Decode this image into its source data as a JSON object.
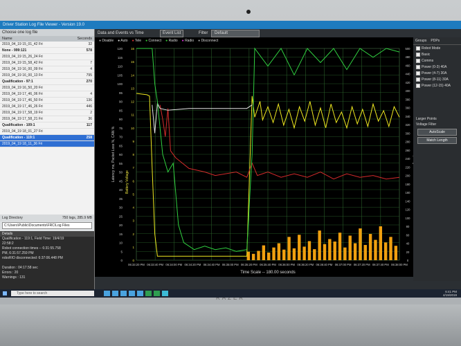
{
  "window": {
    "title": "Driver Station Log File Viewer - Version 19.0"
  },
  "sidebar": {
    "header": "Choose one log file",
    "columns": [
      "Name",
      "Seconds"
    ],
    "rows": [
      {
        "name": "2019_04_19 15_01_42 Fri",
        "value": "32"
      },
      {
        "name": "None - 999:121",
        "value": "578"
      },
      {
        "name": "2019_04_19 15_26_24 Fri",
        "value": ""
      },
      {
        "name": "2019_04_19 15_58_42 Fri",
        "value": "7"
      },
      {
        "name": "2019_04_19 16_00_09 Fri",
        "value": "4"
      },
      {
        "name": "2019_04_19 16_00_13 Fri",
        "value": "795"
      },
      {
        "name": "Qualification - 97:1",
        "value": "270"
      },
      {
        "name": "2019_04_19 16_50_20 Fri",
        "value": ""
      },
      {
        "name": "2019_04_19 17_46_06 Fri",
        "value": "4"
      },
      {
        "name": "2019_04_19 17_46_50 Fri",
        "value": "136"
      },
      {
        "name": "2019_04_19 17_46_26 Fri",
        "value": "446"
      },
      {
        "name": "2019_04_19 17_58_19 Fri",
        "value": "2"
      },
      {
        "name": "2019_04_19 17_58_21 Fri",
        "value": "36"
      },
      {
        "name": "Qualification - 109:1",
        "value": "117"
      },
      {
        "name": "2019_04_19 18_01_27 Fri",
        "value": ""
      },
      {
        "name": "Qualification - 119:1",
        "value": "258"
      },
      {
        "name": "2019_04_19 18_11_36 Fri",
        "value": ""
      }
    ],
    "log_dir_label": "Log Directory",
    "log_dir_info": "750 logs, 285.9 MB",
    "log_path": "C:\\Users\\Public\\Documents\\FRC\\Log Files"
  },
  "details": {
    "header": "Details",
    "lines": [
      "Qualification - 119:1, Field Time: 19/4/19",
      "22:58:2",
      "Robot connection times -- 6:31:55.758",
      "PM, 6:31:57.259 PM",
      "roboRIO disconnected: 6:37:06.448 PM",
      "",
      "Duration : 04:17.58 sec",
      "Errors : 20",
      "Warnings : 131"
    ]
  },
  "topbar": {
    "view_label": "Data and Events vs Time",
    "event_tab": "Event List",
    "filter_label": "Filter",
    "filter_value": "Default"
  },
  "legend": [
    "Disable",
    "Auto",
    "Tele",
    "Connect",
    "Radio",
    "Radio",
    "Disconnect"
  ],
  "right_panel": {
    "tabs": [
      "Groups",
      "PDPs"
    ],
    "checks": [
      "Robot Mode",
      "Basic",
      "Comms",
      "Power (0-3) 40A",
      "Power (4-7) 30A",
      "Power (8-11) 30A",
      "Power (12-15) 40A"
    ],
    "larger_points": "Larger Points",
    "voltage_filter": "Voltage Filter",
    "autoscale": "AutoScale",
    "match_length": "Match Length"
  },
  "chart_data": {
    "type": "line",
    "xlabel": "Time Scale -- 180.00 seconds",
    "ylabel_left": "Latency ms, Packet Loss %, CAN %",
    "ylabel_right": "PDP Amperage",
    "ylabel_voltage": "Battery Voltage",
    "y_left_ticks": [
      "120",
      "115",
      "110",
      "105",
      "100",
      "95",
      "90",
      "85",
      "80",
      "75",
      "70",
      "65",
      "60",
      "55",
      "50",
      "45",
      "40",
      "35",
      "30",
      "25",
      "20",
      "15",
      "10",
      "5",
      "0"
    ],
    "y_voltage_ticks": [
      "16",
      "15",
      "14",
      "13",
      "12",
      "11",
      "10",
      "9",
      "8",
      "7",
      "6",
      "5",
      "4",
      "3",
      "2",
      "1",
      "0"
    ],
    "y_right_ticks": [
      "500",
      "480",
      "460",
      "440",
      "420",
      "400",
      "380",
      "360",
      "340",
      "320",
      "300",
      "280",
      "260",
      "240",
      "220",
      "200",
      "180",
      "160",
      "140",
      "120",
      "100",
      "80",
      "60",
      "40",
      "20",
      "0"
    ],
    "x_ticks": [
      "06:33:20 PM",
      "06:33:40 PM",
      "06:34:00 PM",
      "06:34:20 PM",
      "06:34:40 PM",
      "06:35:00 PM",
      "06:35:20 PM",
      "06:35:40 PM",
      "06:36:00 PM",
      "06:36:20 PM",
      "06:36:40 PM",
      "06:37:00 PM",
      "06:37:20 PM",
      "06:37:40 PM",
      "06:38:00 PM"
    ],
    "series": [
      {
        "name": "Battery Voltage",
        "color": "#f0ea20",
        "points": [
          [
            0,
            12.6
          ],
          [
            0.04,
            12.5
          ],
          [
            0.05,
            12.4
          ],
          [
            0.06,
            7.0
          ],
          [
            0.07,
            2.0
          ],
          [
            0.08,
            0.3
          ],
          [
            0.42,
            0.3
          ],
          [
            0.44,
            12.4
          ],
          [
            0.45,
            10.8
          ],
          [
            0.47,
            12.0
          ],
          [
            0.48,
            10.6
          ],
          [
            0.5,
            11.6
          ],
          [
            0.52,
            10.4
          ],
          [
            0.54,
            11.8
          ],
          [
            0.56,
            10.2
          ],
          [
            0.58,
            11.4
          ],
          [
            0.6,
            10.0
          ],
          [
            0.62,
            11.6
          ],
          [
            0.64,
            10.5
          ],
          [
            0.66,
            12.0
          ],
          [
            0.68,
            10.2
          ],
          [
            0.7,
            11.5
          ],
          [
            0.72,
            10.0
          ],
          [
            0.74,
            11.8
          ],
          [
            0.76,
            10.4
          ],
          [
            0.78,
            11.2
          ],
          [
            0.8,
            10.0
          ],
          [
            0.82,
            11.6
          ],
          [
            0.84,
            10.3
          ],
          [
            0.86,
            11.4
          ],
          [
            0.88,
            10.1
          ],
          [
            0.9,
            11.8
          ],
          [
            0.92,
            10.5
          ],
          [
            0.94,
            11.3
          ],
          [
            0.96,
            10.1
          ],
          [
            0.98,
            11.6
          ],
          [
            1.0,
            10.8
          ]
        ]
      },
      {
        "name": "CAN %",
        "color": "#d42b2b",
        "points": [
          [
            0.09,
            88
          ],
          [
            0.1,
            80
          ],
          [
            0.11,
            70
          ],
          [
            0.12,
            86
          ],
          [
            0.13,
            62
          ],
          [
            0.15,
            58
          ],
          [
            0.2,
            52
          ],
          [
            0.26,
            50
          ],
          [
            0.3,
            48
          ],
          [
            0.38,
            50
          ],
          [
            0.42,
            47
          ],
          [
            0.44,
            55
          ],
          [
            0.46,
            48
          ],
          [
            0.5,
            50
          ],
          [
            0.55,
            47
          ],
          [
            0.6,
            49
          ],
          [
            0.65,
            47
          ],
          [
            0.7,
            50
          ],
          [
            0.75,
            46
          ],
          [
            0.8,
            49
          ],
          [
            0.85,
            47
          ],
          [
            0.9,
            48
          ],
          [
            0.95,
            46
          ],
          [
            1.0,
            47
          ]
        ]
      },
      {
        "name": "Packet Loss %",
        "color": "#e6e6e6",
        "points": [
          [
            0.06,
            88
          ],
          [
            0.07,
            72
          ],
          [
            0.08,
            89
          ],
          [
            0.09,
            86
          ],
          [
            0.12,
            85
          ],
          [
            0.2,
            86
          ],
          [
            0.3,
            86
          ],
          [
            0.42,
            86
          ],
          [
            0.44,
            88
          ]
        ]
      },
      {
        "name": "Latency ms",
        "color": "#30d040",
        "points": [
          [
            0.0,
            120
          ],
          [
            0.06,
            120
          ],
          [
            0.07,
            100
          ],
          [
            0.08,
            90
          ],
          [
            0.1,
            60
          ],
          [
            0.12,
            50
          ],
          [
            0.14,
            55
          ],
          [
            0.16,
            20
          ],
          [
            0.18,
            10
          ],
          [
            0.22,
            6
          ],
          [
            0.26,
            8
          ],
          [
            0.3,
            6
          ],
          [
            0.34,
            7
          ],
          [
            0.38,
            5
          ],
          [
            0.42,
            6
          ],
          [
            0.44,
            60
          ],
          [
            0.45,
            120
          ],
          [
            0.5,
            110
          ],
          [
            0.55,
            120
          ],
          [
            0.6,
            105
          ],
          [
            0.65,
            120
          ],
          [
            0.7,
            112
          ],
          [
            0.75,
            120
          ],
          [
            0.8,
            108
          ],
          [
            0.85,
            120
          ],
          [
            0.9,
            115
          ],
          [
            0.95,
            120
          ],
          [
            1.0,
            118
          ]
        ]
      }
    ],
    "amperage_bars": [
      20,
      15,
      22,
      35,
      18,
      30,
      40,
      25,
      55,
      28,
      60,
      32,
      45,
      26,
      70,
      38,
      50,
      44,
      65,
      30,
      58,
      40,
      75,
      36,
      62,
      48,
      80,
      42,
      55,
      34
    ]
  },
  "taskbar": {
    "search_placeholder": "Type here to search",
    "time": "6:41 PM",
    "date": "4/19/2019"
  },
  "brand": "RAZER"
}
